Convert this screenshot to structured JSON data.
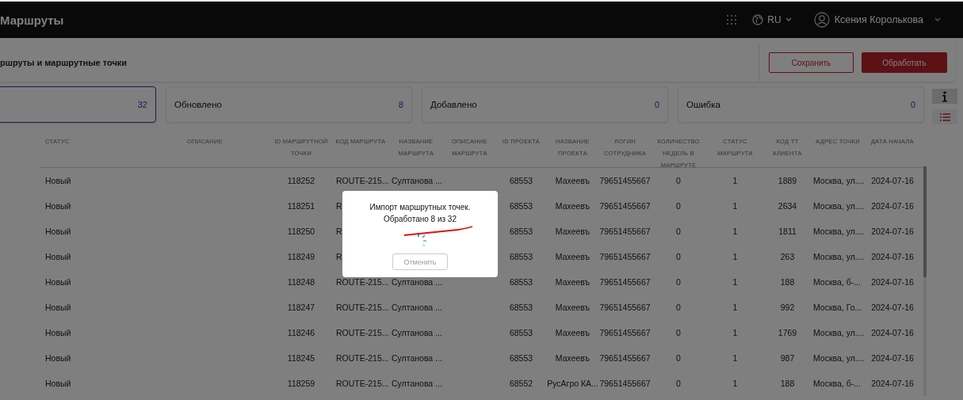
{
  "header": {
    "title": "Маршруты",
    "language": "RU",
    "user_name": "Ксения Королькова"
  },
  "toolbar": {
    "subtitle": "ршруты и маршрутные точки",
    "buttons": [
      {
        "label": "Сохранить",
        "kind": "outline"
      },
      {
        "label": "Обработать",
        "kind": "primary"
      }
    ]
  },
  "stat_cards": [
    {
      "value": "32",
      "selected": true
    },
    {
      "label": "Обновлено",
      "value": "8",
      "selected": false
    },
    {
      "label": "Добавлено",
      "value": "0",
      "selected": false
    },
    {
      "label": "Ошибка",
      "value": "0",
      "selected": false
    }
  ],
  "table": {
    "columns": [
      "СТАТУС",
      "ОПИСАНИЕ",
      "ID МАРШРУТНОЙ ТОЧКИ",
      "КОД МАРШРУТА",
      "НАЗВАНИЕ МАРШРУТА",
      "ОПИСАНИЕ МАРШРУТА",
      "ID ПРОЕКТА",
      "НАЗВАНИЕ ПРОЕКТА",
      "ЛОГИН СОТРУДНИКА",
      "КОЛИЧЕСТВО НЕДЕЛЬ В МАРШРУТЕ",
      "СТАТУС МАРШРУТА",
      "КОД ТТ КЛИЕНТА",
      "АДРЕС ТОЧКИ",
      "ДАТА НАЧАЛА"
    ],
    "rows": [
      {
        "cells": [
          "Новый",
          null,
          "118252",
          "ROUTE-215...",
          "Султанова ...",
          null,
          "68553",
          "Махеевъ",
          "79651455667",
          "0",
          "1",
          "1889",
          "Москва, ул....",
          "2024-07-16"
        ]
      },
      {
        "cells": [
          "Новый",
          null,
          "118251",
          "R",
          null,
          null,
          "68553",
          "Махеевъ",
          "79651455667",
          "0",
          "1",
          "2634",
          "Москва, ул....",
          "2024-07-16"
        ]
      },
      {
        "cells": [
          "Новый",
          null,
          "118250",
          "R",
          null,
          null,
          "68553",
          "Махеевъ",
          "79651455667",
          "0",
          "1",
          "1811",
          "Москва, ул....",
          "2024-07-16"
        ]
      },
      {
        "cells": [
          "Новый",
          null,
          "118249",
          "R",
          null,
          null,
          "68553",
          "Махеевъ",
          "79651455667",
          "0",
          "1",
          "263",
          "Москва, ул....",
          "2024-07-16"
        ]
      },
      {
        "cells": [
          "Новый",
          null,
          "118248",
          "ROUTE-215...",
          "Султанова ...",
          null,
          "68553",
          "Махеевъ",
          "79651455667",
          "0",
          "1",
          "188",
          "Москва, б-...",
          "2024-07-16"
        ]
      },
      {
        "cells": [
          "Новый",
          null,
          "118247",
          "ROUTE-215...",
          "Султанова ...",
          null,
          "68553",
          "Махеевъ",
          "79651455667",
          "0",
          "1",
          "992",
          "Москва, Го...",
          "2024-07-16"
        ]
      },
      {
        "cells": [
          "Новый",
          null,
          "118246",
          "ROUTE-215...",
          "Султанова ...",
          null,
          "68553",
          "Махеевъ",
          "79651455667",
          "0",
          "1",
          "1769",
          "Москва, ул....",
          "2024-07-16"
        ]
      },
      {
        "cells": [
          "Новый",
          null,
          "118245",
          "ROUTE-215...",
          "Султанова ...",
          null,
          "68553",
          "Махеевъ",
          "79651455667",
          "0",
          "1",
          "987",
          "Москва, ул....",
          "2024-07-16"
        ]
      },
      {
        "cells": [
          "Новый",
          null,
          "118259",
          "ROUTE-215...",
          "Султанова ...",
          null,
          "68552",
          "РусАгро КА...",
          "79651455667",
          "0",
          "1",
          "188",
          "Москва, б-...",
          "2024-07-16"
        ]
      }
    ]
  },
  "dialog": {
    "message": "Импорт маршрутных точек.",
    "progress": "Обработано 8 из 32",
    "cancel_button": {
      "label": "Отменить",
      "disabled": true
    }
  }
}
